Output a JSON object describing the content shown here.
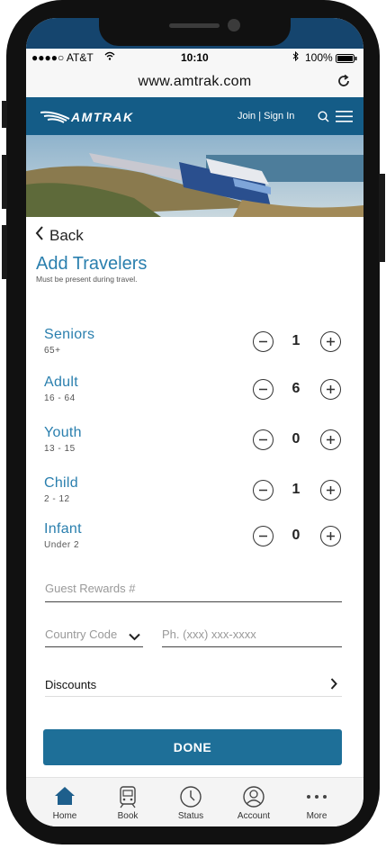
{
  "status": {
    "carrier": "●●●●○ AT&T",
    "time": "10:10",
    "battery": "100%"
  },
  "browser": {
    "url": "www.amtrak.com"
  },
  "header": {
    "logo": "AMTRAK",
    "join_signin": "Join | Sign In"
  },
  "nav": {
    "back_label": "Back"
  },
  "page": {
    "title": "Add Travelers",
    "subtitle": "Must be present during travel."
  },
  "travelers": [
    {
      "name": "Seniors",
      "range": "65+",
      "count": "1"
    },
    {
      "name": "Adult",
      "range": "16 - 64",
      "count": "6"
    },
    {
      "name": "Youth",
      "range": "13 - 15",
      "count": "0"
    },
    {
      "name": "Child",
      "range": "2 - 12",
      "count": "1"
    },
    {
      "name": "Infant",
      "range": "Under 2",
      "count": "0"
    }
  ],
  "form": {
    "rewards_placeholder": "Guest Rewards #",
    "country_code_label": "Country Code",
    "phone_placeholder": "Ph. (xxx) xxx-xxxx",
    "discounts_label": "Discounts",
    "done_label": "DONE"
  },
  "tabs": [
    {
      "label": "Home",
      "icon": "house-icon"
    },
    {
      "label": "Book",
      "icon": "train-icon"
    },
    {
      "label": "Status",
      "icon": "clock-icon"
    },
    {
      "label": "Account",
      "icon": "user-icon"
    },
    {
      "label": "More",
      "icon": "dots-icon"
    }
  ],
  "colors": {
    "brand_blue": "#145c87",
    "accent_blue": "#2a7fae",
    "button_blue": "#1e6f98"
  }
}
